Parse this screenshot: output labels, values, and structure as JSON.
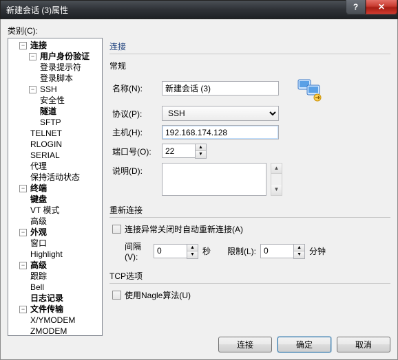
{
  "window": {
    "title": "新建会话 (3)属性"
  },
  "category_label": "类别(C):",
  "tree": {
    "connection": "连接",
    "auth": "用户身份验证",
    "login_prompt": "登录提示符",
    "login_script": "登录脚本",
    "ssh": "SSH",
    "security": "安全性",
    "tunnel": "隧道",
    "sftp": "SFTP",
    "telnet": "TELNET",
    "rlogin": "RLOGIN",
    "serial": "SERIAL",
    "proxy": "代理",
    "keepalive": "保持活动状态",
    "terminal": "终端",
    "keyboard": "键盘",
    "vt": "VT 模式",
    "adv_term": "高级",
    "appearance": "外观",
    "window_": "窗口",
    "highlight": "Highlight",
    "advanced": "高级",
    "trace": "跟踪",
    "bell": "Bell",
    "log": "日志记录",
    "file_transfer": "文件传输",
    "xymodem": "X/YMODEM",
    "zmodem": "ZMODEM"
  },
  "panel": {
    "title": "连接",
    "general_title": "常规",
    "name_label": "名称(N):",
    "name_value": "新建会话 (3)",
    "protocol_label": "协议(P):",
    "protocol_value": "SSH",
    "host_label": "主机(H):",
    "host_value": "192.168.174.128",
    "port_label": "端口号(O):",
    "port_value": "22",
    "desc_label": "说明(D):",
    "desc_value": ""
  },
  "reconnect": {
    "title": "重新连接",
    "auto_label": "连接异常关闭时自动重新连接(A)",
    "interval_label": "间隔(V):",
    "interval_value": "0",
    "seconds": "秒",
    "limit_label": "限制(L):",
    "limit_value": "0",
    "minutes": "分钟"
  },
  "tcp": {
    "title": "TCP选项",
    "nagle_label": "使用Nagle算法(U)"
  },
  "buttons": {
    "connect": "连接",
    "ok": "确定",
    "cancel": "取消"
  }
}
